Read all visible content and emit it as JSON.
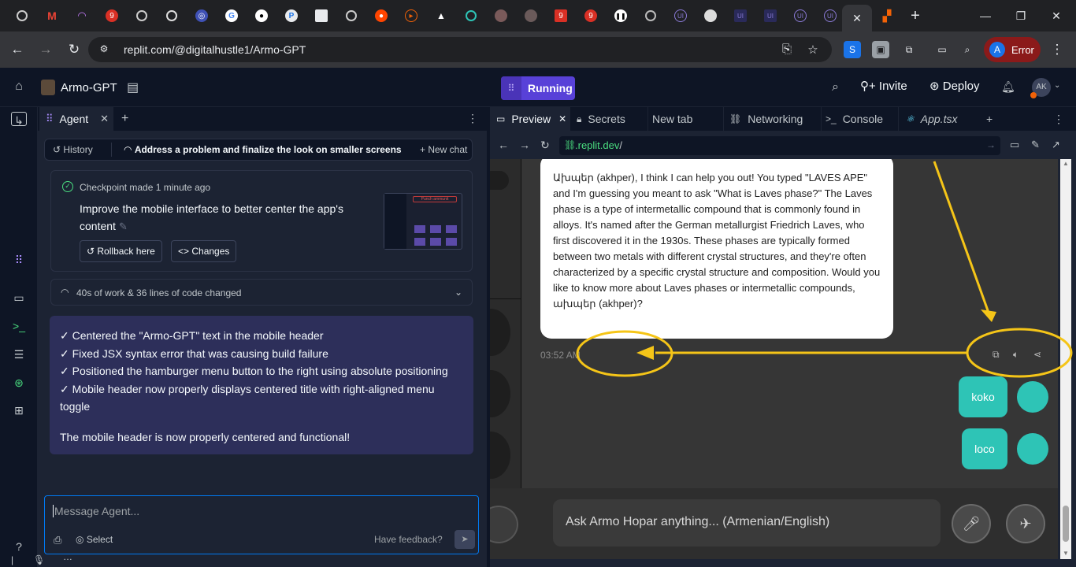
{
  "browser": {
    "url_host": "replit.com",
    "url_path": "/@digitalhustle1/Armo-GPT",
    "profile_initial": "A",
    "profile_label": "Error",
    "tab_badge_1": "9",
    "tab_badge_2": "9"
  },
  "header": {
    "project_title": "Armo-GPT",
    "run_label": "Running",
    "invite_label": "Invite",
    "deploy_label": "Deploy",
    "avatar_initials": "AK"
  },
  "agent": {
    "tab_label": "Agent",
    "history_label": "History",
    "thread_title": "Address a problem and finalize the look on smaller screens",
    "new_chat_label": "New chat",
    "checkpoint": {
      "meta": "Checkpoint made 1 minute ago",
      "title": "Improve the mobile interface to better center the app's content",
      "rollback_label": "Rollback here",
      "changes_label": "Changes",
      "thumb_header": "Punch ammunit"
    },
    "work_summary": "40s of work & 36 lines of code changed",
    "summary_lines": [
      "✓ Centered the \"Armo-GPT\" text in the mobile header",
      "✓ Fixed JSX syntax error that was causing build failure",
      "✓ Positioned the hamburger menu button to the right using absolute positioning",
      "✓ Mobile header now properly displays centered title with right-aligned menu toggle"
    ],
    "summary_final": "The mobile header is now properly centered and functional!",
    "input_placeholder": "Message Agent...",
    "select_label": "Select",
    "feedback_label": "Have feedback?"
  },
  "workspace": {
    "tabs": [
      {
        "label": "Preview"
      },
      {
        "label": "Secrets"
      },
      {
        "label": "New tab"
      },
      {
        "label": "Networking"
      },
      {
        "label": "Console"
      },
      {
        "label": "App.tsx"
      }
    ],
    "webview_host": ".replit.dev",
    "webview_path": "/"
  },
  "preview": {
    "ai_message": "Ախպեր (akhper), I think I can help you out! You typed \"LAVES APE\" and I'm guessing you meant to ask \"What is Laves phase?\" The Laves phase is a type of intermetallic compound that is commonly found in alloys. It's named after the German metallurgist Friedrich Laves, who first discovered it in the 1930s. These phases are typically formed between two metals with different crystal structures, and they're often characterized by a specific crystal structure and composition. Would you like to know more about Laves phases or intermetallic compounds, ախպեր (akhper)?",
    "ai_time": "03:52 AM",
    "user_messages": [
      "koko",
      "loco"
    ],
    "input_placeholder": "Ask Armo Hopar anything... (Armenian/English)"
  },
  "colors": {
    "accent": "#5841d8",
    "user_bubble": "#2ec4b6",
    "annotation": "#f5c518"
  }
}
